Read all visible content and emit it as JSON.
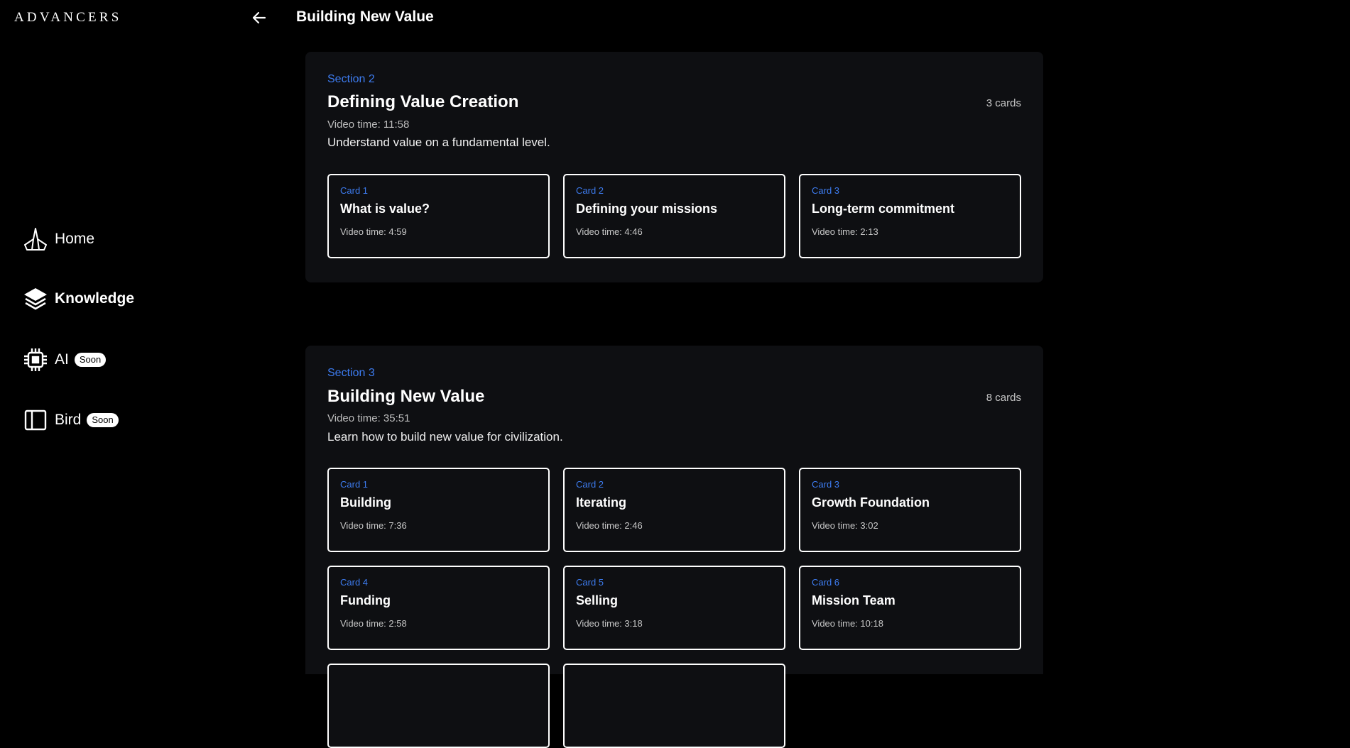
{
  "brand": {
    "logo": "ADVANCERS"
  },
  "header": {
    "title": "Building New Value",
    "back_icon": "arrow-left-icon"
  },
  "nav": [
    {
      "label": "Home",
      "icon": "ship-icon",
      "badge": ""
    },
    {
      "label": "Knowledge",
      "icon": "layers-icon",
      "badge": ""
    },
    {
      "label": "AI",
      "icon": "chip-icon",
      "badge": "Soon"
    },
    {
      "label": "Bird",
      "icon": "panel-icon",
      "badge": "Soon"
    }
  ],
  "sections": [
    {
      "label": "Section 2",
      "title": "Defining Value Creation",
      "count": "3 cards",
      "time": "Video time: 11:58",
      "description": "Understand value on a fundamental level.",
      "cards": [
        {
          "label": "Card 1",
          "title": "What is value?",
          "time": "Video time: 4:59"
        },
        {
          "label": "Card 2",
          "title": "Defining your missions",
          "time": "Video time: 4:46"
        },
        {
          "label": "Card 3",
          "title": "Long-term commitment",
          "time": "Video time: 2:13"
        }
      ]
    },
    {
      "label": "Section 3",
      "title": "Building New Value",
      "count": "8 cards",
      "time": "Video time: 35:51",
      "description": "Learn how to build new value for civilization.",
      "cards": [
        {
          "label": "Card 1",
          "title": "Building",
          "time": "Video time: 7:36"
        },
        {
          "label": "Card 2",
          "title": "Iterating",
          "time": "Video time: 2:46"
        },
        {
          "label": "Card 3",
          "title": "Growth Foundation",
          "time": "Video time: 3:02"
        },
        {
          "label": "Card 4",
          "title": "Funding",
          "time": "Video time: 2:58"
        },
        {
          "label": "Card 5",
          "title": "Selling",
          "time": "Video time: 3:18"
        },
        {
          "label": "Card 6",
          "title": "Mission Team",
          "time": "Video time: 10:18"
        },
        {
          "label": "",
          "title": "",
          "time": ""
        },
        {
          "label": "",
          "title": "",
          "time": ""
        }
      ]
    }
  ],
  "colors": {
    "background": "#000000",
    "panel": "#0e0f12",
    "accent": "#3d7cf0",
    "text": "#ffffff"
  }
}
